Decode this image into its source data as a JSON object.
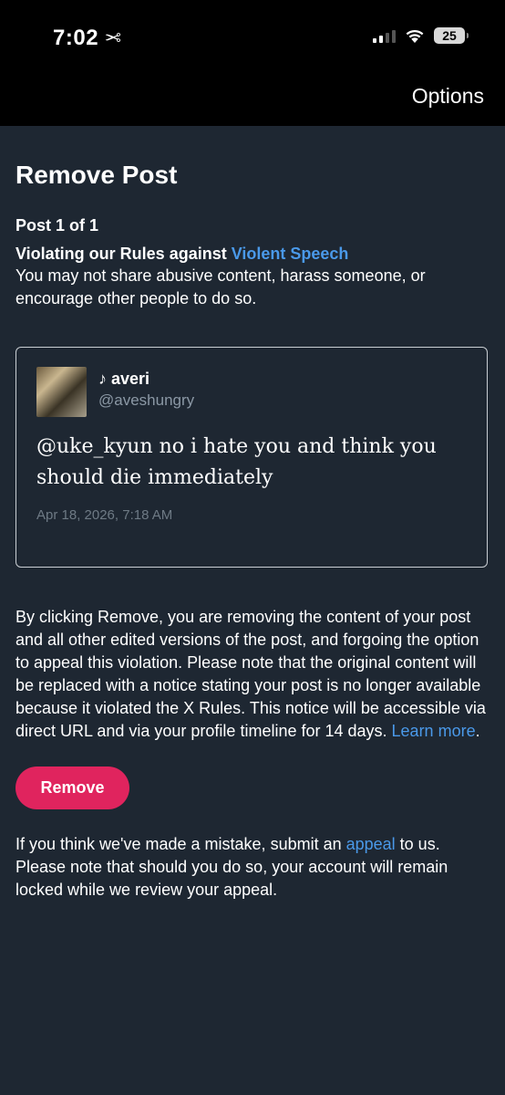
{
  "status_bar": {
    "time": "7:02",
    "battery": "25"
  },
  "nav": {
    "options_label": "Options"
  },
  "page": {
    "title": "Remove Post",
    "post_count": "Post 1 of 1",
    "violation_prefix": "Violating our Rules against ",
    "violation_rule": "Violent Speech",
    "violation_description": "You may not share abusive content, harass someone, or encourage other people to do so."
  },
  "tweet": {
    "display_name": "♪ averi",
    "handle": "@aveshungry",
    "text": "@uke_kyun no i hate you and think you should die immediately",
    "timestamp": "Apr 18, 2026, 7:18 AM"
  },
  "explanation": {
    "text": "By clicking Remove, you are removing the content of your post and all other edited versions of the post, and forgoing the option to appeal this violation. Please note that the original content will be replaced with a notice stating your post is no longer available because it violated the X Rules. This notice will be accessible via direct URL and via your profile timeline for 14 days. ",
    "learn_more": "Learn more",
    "suffix": "."
  },
  "actions": {
    "remove_label": "Remove"
  },
  "appeal": {
    "prefix": "If you think we've made a mistake, submit an ",
    "link": "appeal",
    "suffix": " to us. Please note that should you do so, your account will remain locked while we review your appeal."
  },
  "colors": {
    "background": "#1e2732",
    "link": "#4a99e9",
    "remove_button": "#e0245e"
  }
}
